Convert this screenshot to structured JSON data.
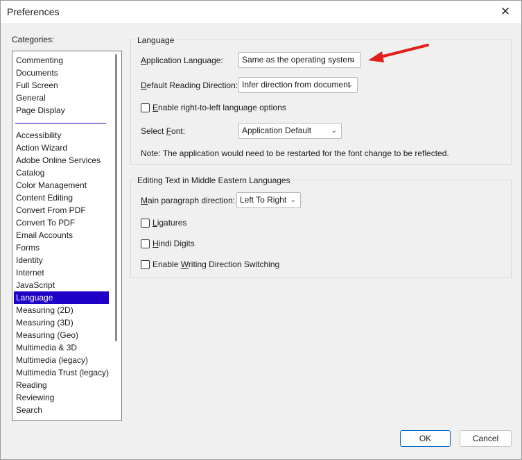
{
  "window": {
    "title": "Preferences"
  },
  "categories": {
    "label": "Categories:",
    "group1": [
      "Commenting",
      "Documents",
      "Full Screen",
      "General",
      "Page Display"
    ],
    "group2": [
      "Accessibility",
      "Action Wizard",
      "Adobe Online Services",
      "Catalog",
      "Color Management",
      "Content Editing",
      "Convert From PDF",
      "Convert To PDF",
      "Email Accounts",
      "Forms",
      "Identity",
      "Internet",
      "JavaScript",
      "Language",
      "Measuring (2D)",
      "Measuring (3D)",
      "Measuring (Geo)",
      "Multimedia & 3D",
      "Multimedia (legacy)",
      "Multimedia Trust (legacy)",
      "Reading",
      "Reviewing",
      "Search"
    ],
    "selected": "Language",
    "selected_color": "#1e00c7"
  },
  "language_group": {
    "title": "Language",
    "app_language": {
      "label": "Application Language:",
      "value": "Same as the operating system"
    },
    "reading_direction": {
      "label": "Default Reading Direction:",
      "value": "Infer direction from document"
    },
    "rtl_options": {
      "label": "Enable right-to-left language options",
      "checked": false
    },
    "select_font": {
      "label": "Select Font:",
      "value": "Application Default"
    },
    "note": "Note: The application would need to be restarted for the font change to be reflected."
  },
  "middle_eastern_group": {
    "title": "Editing Text in Middle Eastern Languages",
    "paragraph_direction": {
      "label": "Main paragraph direction:",
      "value": "Left To Right"
    },
    "ligatures": {
      "label": "Ligatures",
      "checked": false
    },
    "hindi_digits": {
      "label": "Hindi Digits",
      "checked": false
    },
    "writing_direction_switching": {
      "label": "Enable Writing Direction Switching",
      "checked": false
    }
  },
  "buttons": {
    "ok": "OK",
    "cancel": "Cancel"
  },
  "annotation": {
    "arrow_color": "#e0201b"
  }
}
